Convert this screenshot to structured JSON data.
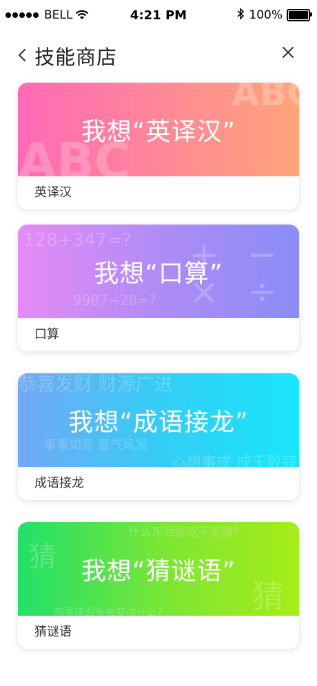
{
  "status_bar": {
    "carrier": "BELL",
    "time": "4:21 PM",
    "battery": "100%",
    "battery_level": 1.0,
    "signal_bars": 5
  },
  "header": {
    "title": "技能商店",
    "back_icon": "chevron-left-icon",
    "close_icon": "close-icon"
  },
  "cards": [
    {
      "banner_text": "我想“英译汉”",
      "label": "英译汉",
      "decorations": [
        "ABC",
        "ABC"
      ],
      "gradient": [
        "#ff6ab6",
        "#ffa478"
      ]
    },
    {
      "banner_text": "我想“口算”",
      "label": "口算",
      "decorations": [
        "128+347=?",
        "9987−28=?",
        "+ −",
        "× ÷"
      ],
      "gradient": [
        "#e58af5",
        "#8a8df6"
      ]
    },
    {
      "banner_text": "我想“成语接龙”",
      "label": "成语接龙",
      "decorations": [
        "恭喜发财 财源广进",
        "事事如意 意气风发",
        "心想事成 成王败寇"
      ],
      "gradient": [
        "#74a8f5",
        "#18e6fb"
      ]
    },
    {
      "banner_text": "我想“猜谜语”",
      "label": "猜谜语",
      "decorations": [
        "什么东西能吃不能碰?",
        "猜",
        "猜",
        "鸡蛋摔跟头会变成什么?"
      ],
      "gradient": [
        "#22e06a",
        "#a6ec19"
      ]
    }
  ]
}
